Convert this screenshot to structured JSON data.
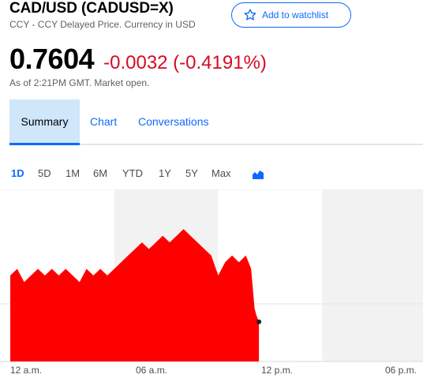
{
  "header": {
    "title": "CAD/USD (CADUSD=X)",
    "subtitle": "CCY - CCY Delayed Price. Currency in USD",
    "watchlist_label": "Add to watchlist"
  },
  "quote": {
    "price": "0.7604",
    "change": "-0.0032 (-0.4191%)",
    "as_of": "As of 2:21PM GMT. Market open."
  },
  "tabs": [
    {
      "label": "Summary",
      "active": true
    },
    {
      "label": "Chart",
      "active": false
    },
    {
      "label": "Conversations",
      "active": false
    }
  ],
  "ranges": [
    {
      "label": "1D",
      "active": true
    },
    {
      "label": "5D",
      "active": false
    },
    {
      "label": "1M",
      "active": false
    },
    {
      "label": "6M",
      "active": false
    },
    {
      "label": "YTD",
      "active": false
    },
    {
      "label": "1Y",
      "active": false
    },
    {
      "label": "5Y",
      "active": false
    },
    {
      "label": "Max",
      "active": false
    }
  ],
  "icons": {
    "watchlist": "star-outline-icon",
    "chart_type": "area-chart-icon"
  },
  "colors": {
    "accent": "#0f69ff",
    "negative": "#d60a22",
    "area_fill": "#ff0000",
    "active_tab_bg": "#cfe6fb",
    "session_band": "#f2f2f2"
  },
  "chart_data": {
    "type": "area",
    "x_tick_labels": [
      "12 a.m.",
      "06 a.m.",
      "12 p.m.",
      "06 p.m."
    ],
    "x_unit": "hours since 12 a.m. GMT",
    "xlim": [
      0,
      24
    ],
    "x": [
      0,
      0.4,
      0.8,
      1.2,
      1.6,
      2.0,
      2.4,
      2.8,
      3.2,
      3.6,
      4.0,
      4.4,
      4.8,
      5.2,
      5.6,
      6.0,
      6.4,
      6.8,
      7.2,
      7.6,
      8.0,
      8.4,
      8.8,
      9.2,
      9.6,
      10.0,
      10.4,
      10.8,
      11.2,
      11.6,
      12.0,
      12.4,
      12.8,
      13.2,
      13.6,
      13.9,
      14.0,
      14.1,
      14.2,
      14.35
    ],
    "y": [
      0.7611,
      0.7612,
      0.761,
      0.7611,
      0.7612,
      0.7611,
      0.7612,
      0.7611,
      0.7612,
      0.7611,
      0.761,
      0.7612,
      0.7611,
      0.7612,
      0.7611,
      0.7612,
      0.7613,
      0.7614,
      0.7615,
      0.7616,
      0.7615,
      0.7616,
      0.7617,
      0.7616,
      0.7617,
      0.7618,
      0.7617,
      0.7616,
      0.7615,
      0.7614,
      0.7611,
      0.7613,
      0.7614,
      0.7613,
      0.7614,
      0.7612,
      0.7609,
      0.7606,
      0.7605,
      0.7604
    ],
    "ylim": [
      0.7598,
      0.7624
    ],
    "session_bands_hours": [
      [
        6,
        12
      ],
      [
        18,
        24
      ]
    ],
    "last_point": {
      "x": 14.35,
      "y": 0.7604
    }
  }
}
